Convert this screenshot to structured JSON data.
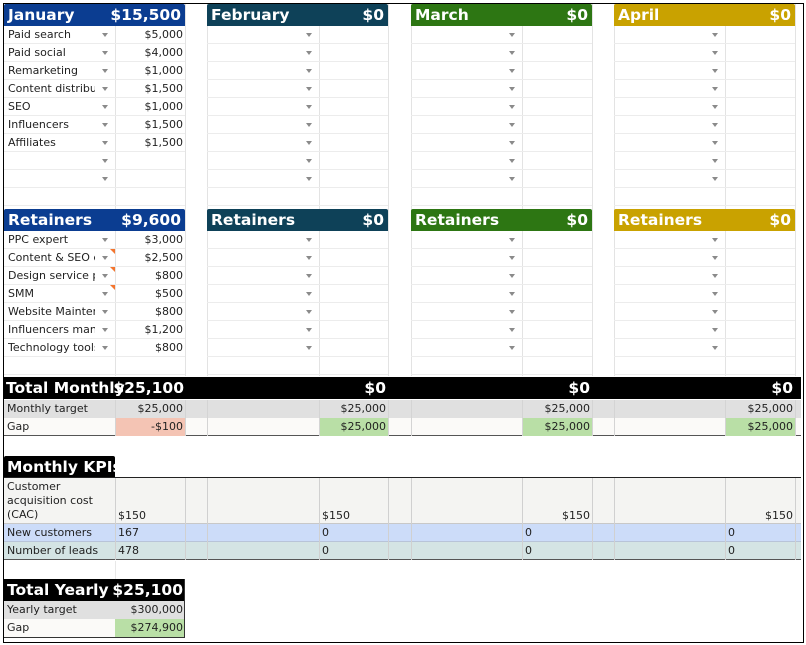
{
  "colors": {
    "january": "#0b3d91",
    "february": "#0e4158",
    "march": "#2d7613",
    "april": "#c9a200",
    "total_bar": "#000000",
    "target_row": "#e0e0e0",
    "gap_negative": "#f4c4b4",
    "gap_positive": "#b9dfa6",
    "kpi_cac_row": "#f4f4f2",
    "kpi_customers_row": "#ccdcf9",
    "kpi_leads_row": "#d4e4e4",
    "note_marker": "#f4752e"
  },
  "months": [
    {
      "name": "January",
      "total": "$15,500",
      "channels": [
        {
          "label": "Paid search",
          "value": "$5,000"
        },
        {
          "label": "Paid social",
          "value": "$4,000"
        },
        {
          "label": "Remarketing",
          "value": "$1,000"
        },
        {
          "label": "Content distributi",
          "value": "$1,500"
        },
        {
          "label": "SEO",
          "value": "$1,000"
        },
        {
          "label": "Influencers",
          "value": "$1,500"
        },
        {
          "label": "Affiliates",
          "value": "$1,500"
        },
        {
          "label": "",
          "value": ""
        },
        {
          "label": "",
          "value": ""
        }
      ],
      "retainers_label": "Retainers",
      "retainers_total": "$9,600",
      "retainers": [
        {
          "label": "PPC expert",
          "value": "$3,000",
          "note": false
        },
        {
          "label": "Content & SEO ex",
          "value": "$2,500",
          "note": true
        },
        {
          "label": "Design service pr",
          "value": "$800",
          "note": true
        },
        {
          "label": "SMM",
          "value": "$500",
          "note": true
        },
        {
          "label": "Website Mainten",
          "value": "$800",
          "note": false
        },
        {
          "label": "Influencers mana",
          "value": "$1,200",
          "note": false
        },
        {
          "label": "Technology tools",
          "value": "$800",
          "note": false
        }
      ],
      "monthly_target": "$25,000",
      "gap": "-$100",
      "gap_status": "negative",
      "kpis": {
        "cac": "$150",
        "new_customers": "167",
        "leads": "478"
      }
    },
    {
      "name": "February",
      "total": "$0",
      "channels": [
        {
          "label": "",
          "value": ""
        },
        {
          "label": "",
          "value": ""
        },
        {
          "label": "",
          "value": ""
        },
        {
          "label": "",
          "value": ""
        },
        {
          "label": "",
          "value": ""
        },
        {
          "label": "",
          "value": ""
        },
        {
          "label": "",
          "value": ""
        },
        {
          "label": "",
          "value": ""
        },
        {
          "label": "",
          "value": ""
        }
      ],
      "retainers_label": "Retainers",
      "retainers_total": "$0",
      "retainers": [
        {
          "label": "",
          "value": "",
          "note": false
        },
        {
          "label": "",
          "value": "",
          "note": false
        },
        {
          "label": "",
          "value": "",
          "note": false
        },
        {
          "label": "",
          "value": "",
          "note": false
        },
        {
          "label": "",
          "value": "",
          "note": false
        },
        {
          "label": "",
          "value": "",
          "note": false
        },
        {
          "label": "",
          "value": "",
          "note": false
        }
      ],
      "monthly_total": "$0",
      "monthly_target": "$25,000",
      "gap": "$25,000",
      "gap_status": "positive",
      "kpis": {
        "cac": "$150",
        "new_customers": "0",
        "leads": "0"
      }
    },
    {
      "name": "March",
      "total": "$0",
      "channels": [
        {
          "label": "",
          "value": ""
        },
        {
          "label": "",
          "value": ""
        },
        {
          "label": "",
          "value": ""
        },
        {
          "label": "",
          "value": ""
        },
        {
          "label": "",
          "value": ""
        },
        {
          "label": "",
          "value": ""
        },
        {
          "label": "",
          "value": ""
        },
        {
          "label": "",
          "value": ""
        },
        {
          "label": "",
          "value": ""
        }
      ],
      "retainers_label": "Retainers",
      "retainers_total": "$0",
      "retainers": [
        {
          "label": "",
          "value": "",
          "note": false
        },
        {
          "label": "",
          "value": "",
          "note": false
        },
        {
          "label": "",
          "value": "",
          "note": false
        },
        {
          "label": "",
          "value": "",
          "note": false
        },
        {
          "label": "",
          "value": "",
          "note": false
        },
        {
          "label": "",
          "value": "",
          "note": false
        },
        {
          "label": "",
          "value": "",
          "note": false
        }
      ],
      "monthly_total": "$0",
      "monthly_target": "$25,000",
      "gap": "$25,000",
      "gap_status": "positive",
      "kpis": {
        "cac": "$150",
        "new_customers": "0",
        "leads": "0"
      }
    },
    {
      "name": "April",
      "total": "$0",
      "channels": [
        {
          "label": "",
          "value": ""
        },
        {
          "label": "",
          "value": ""
        },
        {
          "label": "",
          "value": ""
        },
        {
          "label": "",
          "value": ""
        },
        {
          "label": "",
          "value": ""
        },
        {
          "label": "",
          "value": ""
        },
        {
          "label": "",
          "value": ""
        },
        {
          "label": "",
          "value": ""
        },
        {
          "label": "",
          "value": ""
        }
      ],
      "retainers_label": "Retainers",
      "retainers_total": "$0",
      "retainers": [
        {
          "label": "",
          "value": "",
          "note": false
        },
        {
          "label": "",
          "value": "",
          "note": false
        },
        {
          "label": "",
          "value": "",
          "note": false
        },
        {
          "label": "",
          "value": "",
          "note": false
        },
        {
          "label": "",
          "value": "",
          "note": false
        },
        {
          "label": "",
          "value": "",
          "note": false
        },
        {
          "label": "",
          "value": "",
          "note": false
        }
      ],
      "monthly_total": "$0",
      "monthly_target": "$25,000",
      "gap": "$25,000",
      "gap_status": "positive",
      "kpis": {
        "cac": "$150",
        "new_customers": "0",
        "leads": "0"
      }
    }
  ],
  "total_monthly": {
    "label": "Total Monthly",
    "value": "$25,100",
    "target_label": "Monthly target",
    "gap_label": "Gap"
  },
  "kpis": {
    "title": "Monthly KPIs",
    "cac_label": "Customer acquisition cost (CAC)",
    "new_customers_label": "New customers",
    "leads_label": "Number of leads"
  },
  "total_yearly": {
    "label": "Total Yearly",
    "value": "$25,100",
    "target_label": "Yearly target",
    "target_value": "$300,000",
    "gap_label": "Gap",
    "gap_value": "$274,900"
  }
}
